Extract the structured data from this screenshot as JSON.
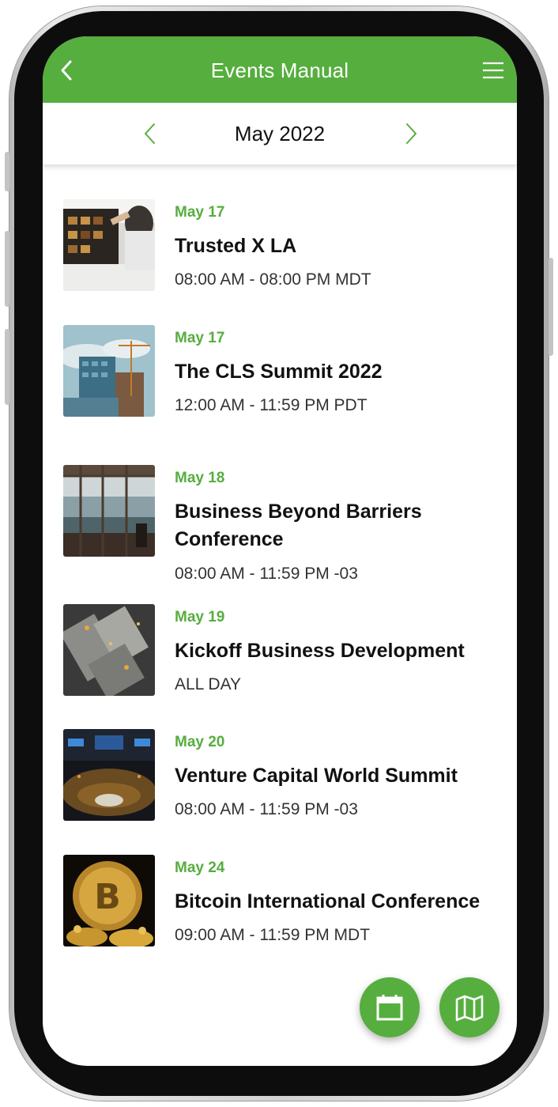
{
  "header": {
    "title": "Events Manual",
    "back_icon": "chevron-left-icon",
    "menu_icon": "hamburger-menu-icon"
  },
  "month_nav": {
    "label": "May 2022",
    "prev_icon": "chevron-left-icon",
    "next_icon": "chevron-right-icon"
  },
  "events": [
    {
      "date": "May 17",
      "title": "Trusted X LA",
      "time": "08:00 AM - 08:00 PM MDT"
    },
    {
      "date": "May 17",
      "title": "The CLS Summit 2022",
      "time": "12:00 AM - 11:59 PM PDT"
    },
    {
      "date": "May 18",
      "title": "Business Beyond Barriers Conference",
      "time": "08:00 AM - 11:59 PM -03"
    },
    {
      "date": "May 19",
      "title": "Kickoff Business Development",
      "time": "ALL DAY"
    },
    {
      "date": "May 20",
      "title": "Venture Capital World Summit",
      "time": "08:00 AM - 11:59 PM -03"
    },
    {
      "date": "May 24",
      "title": "Bitcoin International Conference",
      "time": "09:00 AM - 11:59 PM MDT"
    }
  ],
  "fabs": {
    "calendar_icon": "calendar-icon",
    "map_icon": "map-icon"
  },
  "colors": {
    "accent": "#56ae3e",
    "title_text": "#111111",
    "time_text": "#333333"
  }
}
